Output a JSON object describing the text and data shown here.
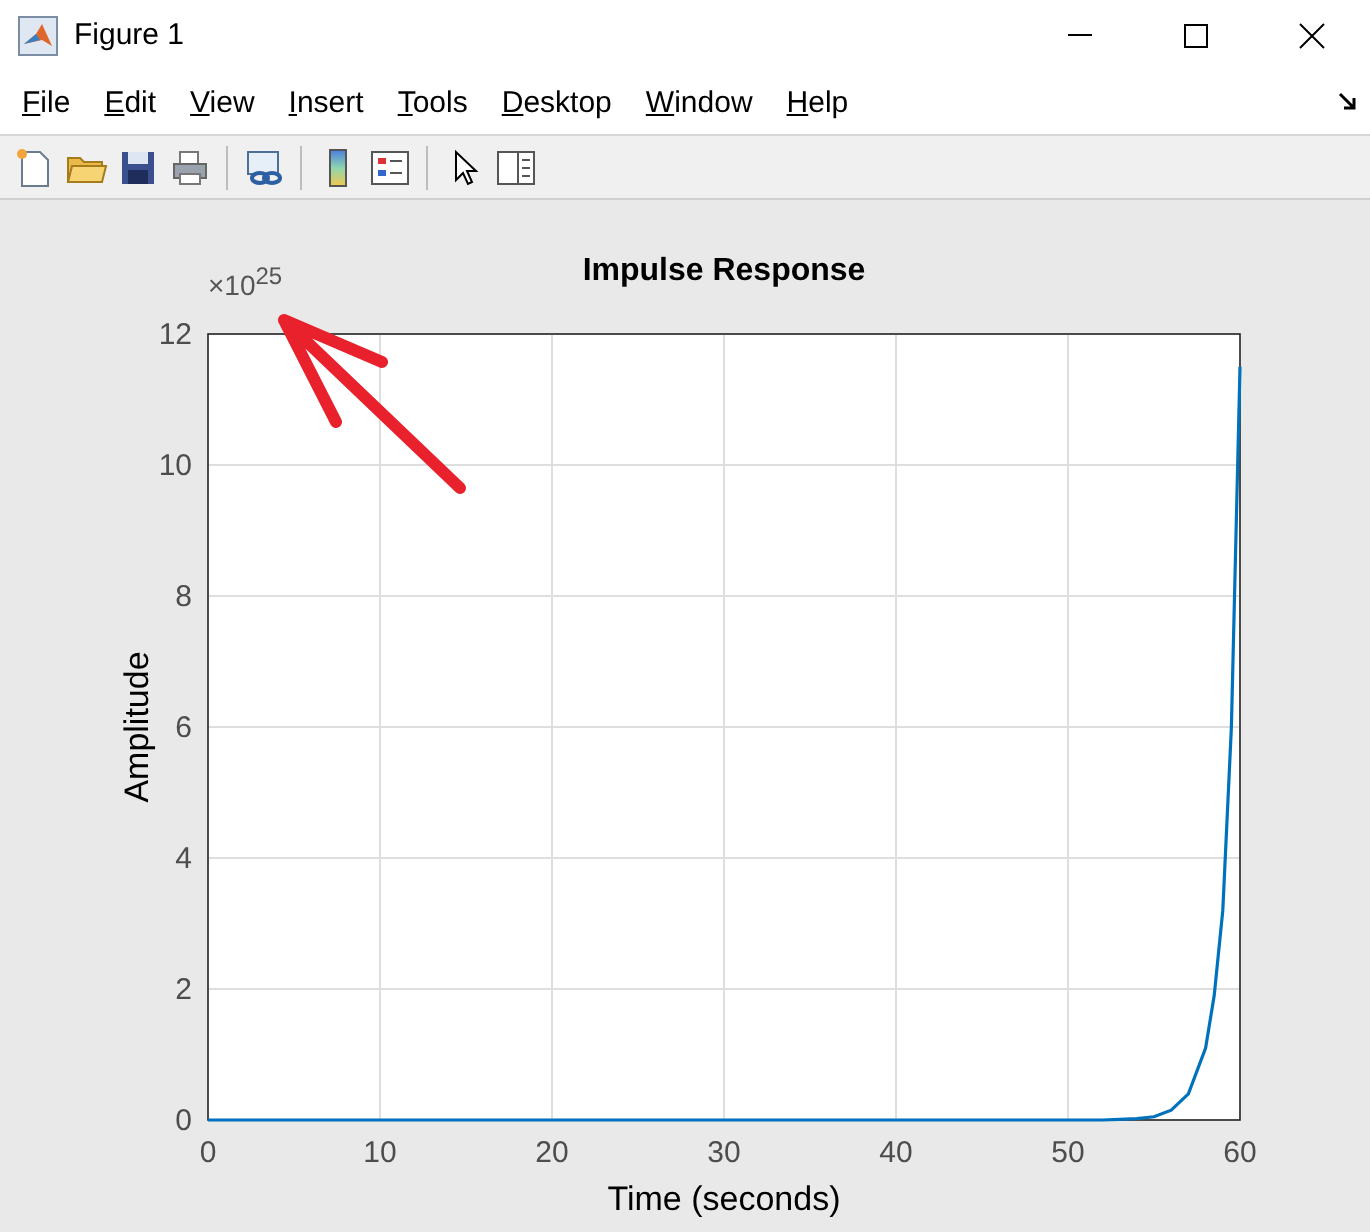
{
  "window": {
    "title": "Figure 1"
  },
  "menu": [
    "File",
    "Edit",
    "View",
    "Insert",
    "Tools",
    "Desktop",
    "Window",
    "Help"
  ],
  "plot": {
    "exponent_label": "×10$^{25}$",
    "chart_data": {
      "type": "line",
      "grid": true,
      "title": "Impulse Response",
      "xlabel": "Time (seconds)",
      "ylabel": "Amplitude",
      "xlim": [
        0,
        60
      ],
      "ylim": [
        0,
        12
      ],
      "xticks": [
        0,
        10,
        20,
        30,
        40,
        50,
        60
      ],
      "yticks": [
        0,
        2,
        4,
        6,
        8,
        10,
        12
      ],
      "x": [
        0,
        10,
        20,
        30,
        40,
        50,
        52,
        53,
        54,
        55,
        56,
        57,
        58,
        58.5,
        59,
        59.5,
        60
      ],
      "series": [
        {
          "color": "#0072bd",
          "values": [
            0,
            0,
            0,
            0,
            0,
            0,
            0,
            0.01,
            0.02,
            0.05,
            0.15,
            0.4,
            1.1,
            1.9,
            3.2,
            6,
            11.5
          ]
        }
      ]
    }
  }
}
